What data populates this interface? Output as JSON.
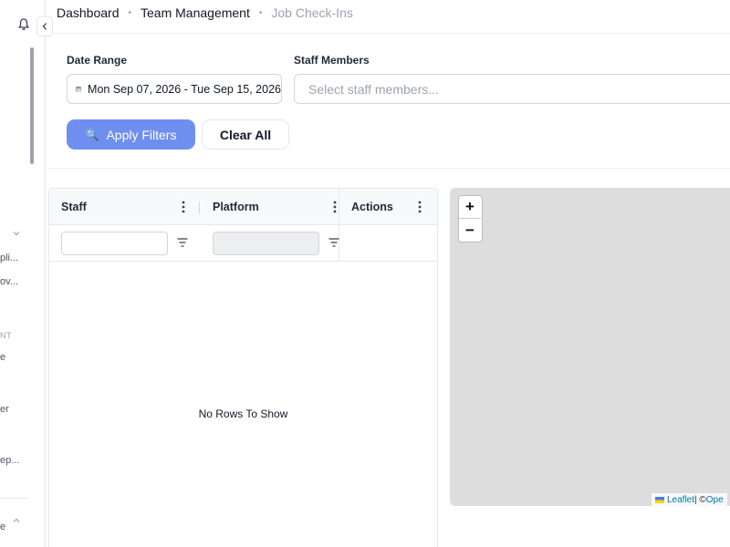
{
  "breadcrumb": {
    "items": [
      "Dashboard",
      "Team Management"
    ],
    "current": "Job Check-Ins"
  },
  "sidebar": {
    "partial_items": [
      "pli...",
      "ov...",
      "e",
      "er",
      "ep...",
      "e"
    ],
    "section_label": "NT"
  },
  "filters": {
    "date_range_label": "Date Range",
    "date_range_value": "Mon Sep 07, 2026 - Tue Sep 15, 2026",
    "staff_label": "Staff Members",
    "staff_placeholder": "Select staff members...",
    "apply_label": "Apply Filters",
    "clear_label": "Clear All"
  },
  "grid": {
    "columns": [
      "Staff",
      "Platform",
      "Actions"
    ],
    "empty_text": "No Rows To Show"
  },
  "map": {
    "zoom_in": "+",
    "zoom_out": "−",
    "attribution_link": "Leaflet",
    "attribution_sep": " | © ",
    "attribution_tail": "Ope"
  },
  "colors": {
    "accent": "#6e8ff0",
    "map_bg": "#dddddd"
  }
}
